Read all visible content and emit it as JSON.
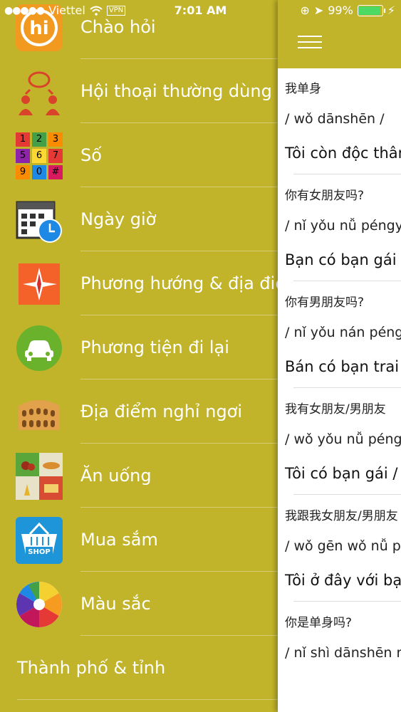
{
  "status": {
    "carrier": "Viettel",
    "vpn": "VPN",
    "time": "7:01 AM",
    "battery": "99%"
  },
  "menu": [
    {
      "label": "Chào hỏi",
      "icon": "hi-icon"
    },
    {
      "label": "Hội thoại thường dùng",
      "icon": "conversation-icon"
    },
    {
      "label": "Số",
      "icon": "numbers-icon"
    },
    {
      "label": "Ngày giờ",
      "icon": "calendar-clock-icon"
    },
    {
      "label": "Phương hướng & địa điểm",
      "icon": "compass-icon"
    },
    {
      "label": "Phương tiện đi lại",
      "icon": "car-icon"
    },
    {
      "label": "Địa điểm nghỉ ngơi",
      "icon": "colosseum-icon"
    },
    {
      "label": "Ăn uống",
      "icon": "food-icon"
    },
    {
      "label": "Mua sắm",
      "icon": "shop-basket-icon"
    },
    {
      "label": "Màu sắc",
      "icon": "color-wheel-icon"
    },
    {
      "label": "Thành phố & tỉnh",
      "icon": ""
    }
  ],
  "shop_text": "SHOP",
  "hi_text": "hi",
  "number_keys": [
    "1",
    "2",
    "3",
    "5",
    "6",
    "7",
    "9",
    "0",
    "#"
  ],
  "phrases": [
    {
      "cn": "我单身",
      "py": "/ wǒ dānshēn /",
      "vi": "Tôi còn độc thân"
    },
    {
      "cn": "你有女朋友吗?",
      "py": "/ nǐ yǒu nǚ péngyou ma /",
      "vi": "Bạn có bạn gái không"
    },
    {
      "cn": "你有男朋友吗?",
      "py": "/ nǐ yǒu nán péngyou ma /",
      "vi": "Bán có bạn trai không"
    },
    {
      "cn": "我有女朋友/男朋友",
      "py": "/ wǒ yǒu nǚ péngyou /",
      "vi": "Tôi có bạn gái / bạn trai"
    },
    {
      "cn": "我跟我女朋友/男朋友",
      "py": "/ wǒ gēn wǒ nǚ péngyou /",
      "vi": "Tôi ở đây với bạn gái"
    },
    {
      "cn": "你是单身吗?",
      "py": "/ nǐ shì dānshēn ma /",
      "vi": ""
    }
  ],
  "colors": {
    "accent": "#c2b42a",
    "panel": "#ffffff"
  }
}
